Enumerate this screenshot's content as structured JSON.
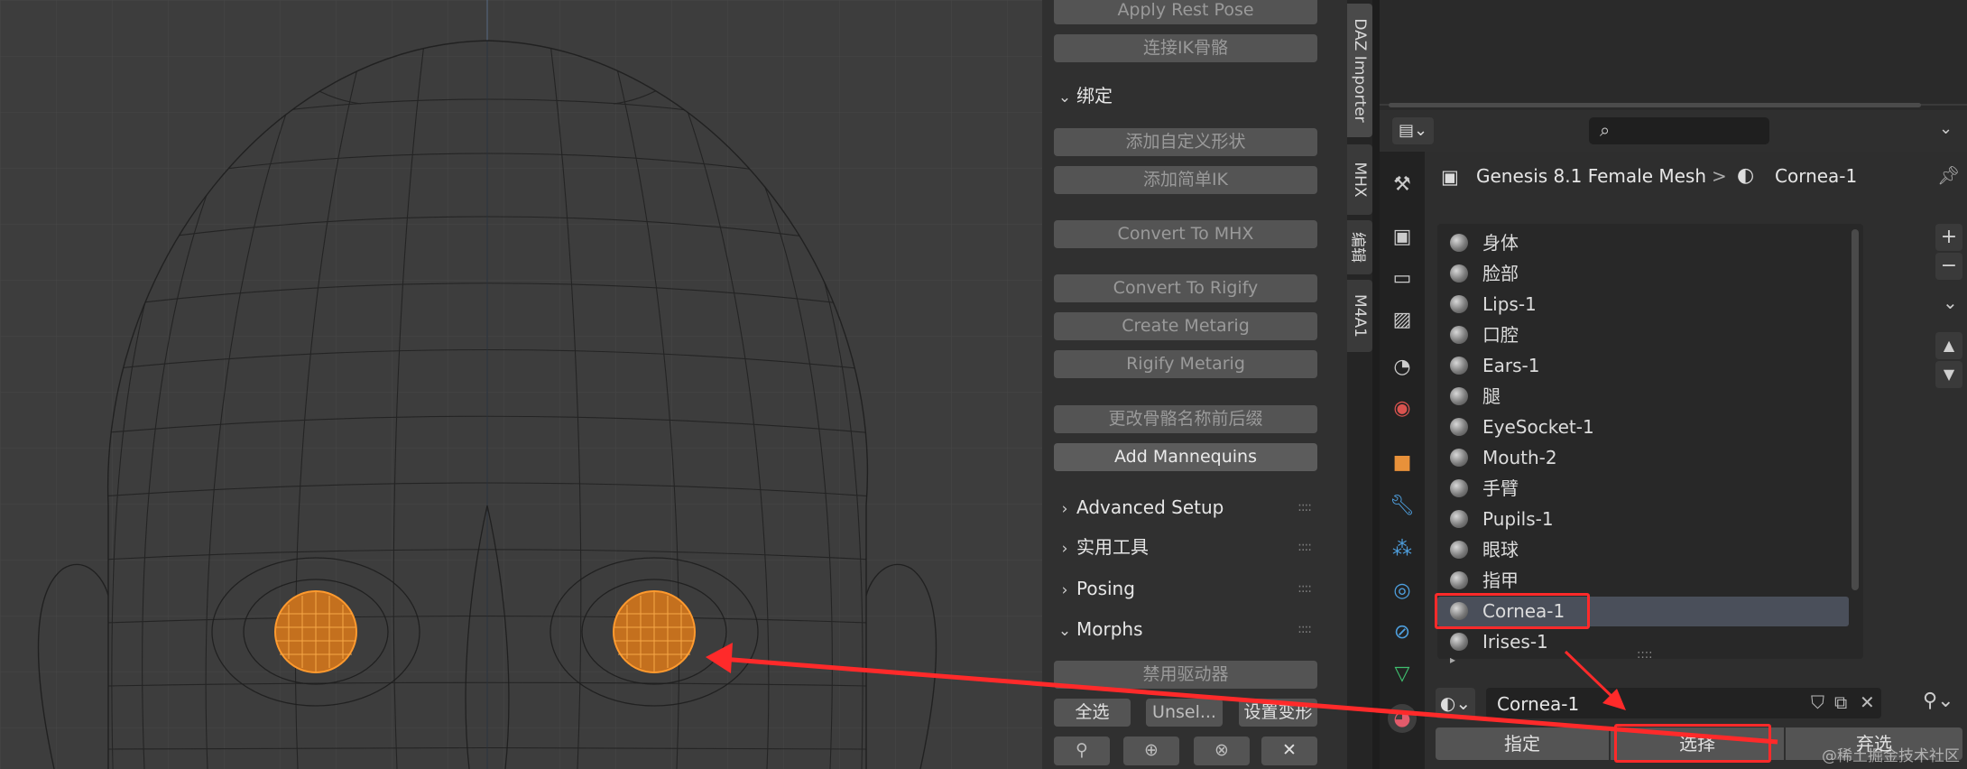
{
  "npanel": {
    "buttons_top": [
      "Apply Rest Pose",
      "连接IK骨骼"
    ],
    "bind_section": "绑定",
    "bind_buttons": [
      "添加自定义形状",
      "添加简单IK",
      "Convert To MHX",
      "Convert To Rigify",
      "Create Metarig",
      "Rigify Metarig",
      "更改骨骼名称前后缀",
      "Add Mannequins"
    ],
    "sections": [
      "Advanced Setup",
      "实用工具",
      "Posing",
      "Morphs"
    ],
    "morph_buttons": {
      "disable_drivers": "禁用驱动器",
      "select_all": "全选",
      "unselect": "Unsel...",
      "set_morph": "设置变形"
    },
    "grip": "::::"
  },
  "vtabs": [
    "DAZ Importer",
    "MHX",
    "编辑",
    "M4A1"
  ],
  "properties": {
    "breadcrumb_object": "Genesis 8.1 Female Mesh",
    "breadcrumb_sep": ">",
    "breadcrumb_material": "Cornea-1",
    "material_slots": [
      "身体",
      "脸部",
      "Lips-1",
      "口腔",
      "Ears-1",
      "腿",
      "EyeSocket-1",
      "Mouth-2",
      "手臂",
      "Pupils-1",
      "眼球",
      "指甲",
      "Cornea-1",
      "Irises-1"
    ],
    "selected_slot": "Cornea-1",
    "material_field": "Cornea-1",
    "buttons": {
      "assign": "指定",
      "select": "选择",
      "deselect": "弃选"
    },
    "list_grip": "::::",
    "side_plus": "+",
    "side_minus": "−",
    "side_down": "⌄",
    "side_up_arrow": "▲",
    "side_down_arrow": "▼"
  },
  "watermark": "@稀土掘金技术社区",
  "colors": {
    "selection_orange": "#ff9a2e",
    "annotation_red": "#ff2a2a",
    "button_gray": "#545454"
  }
}
